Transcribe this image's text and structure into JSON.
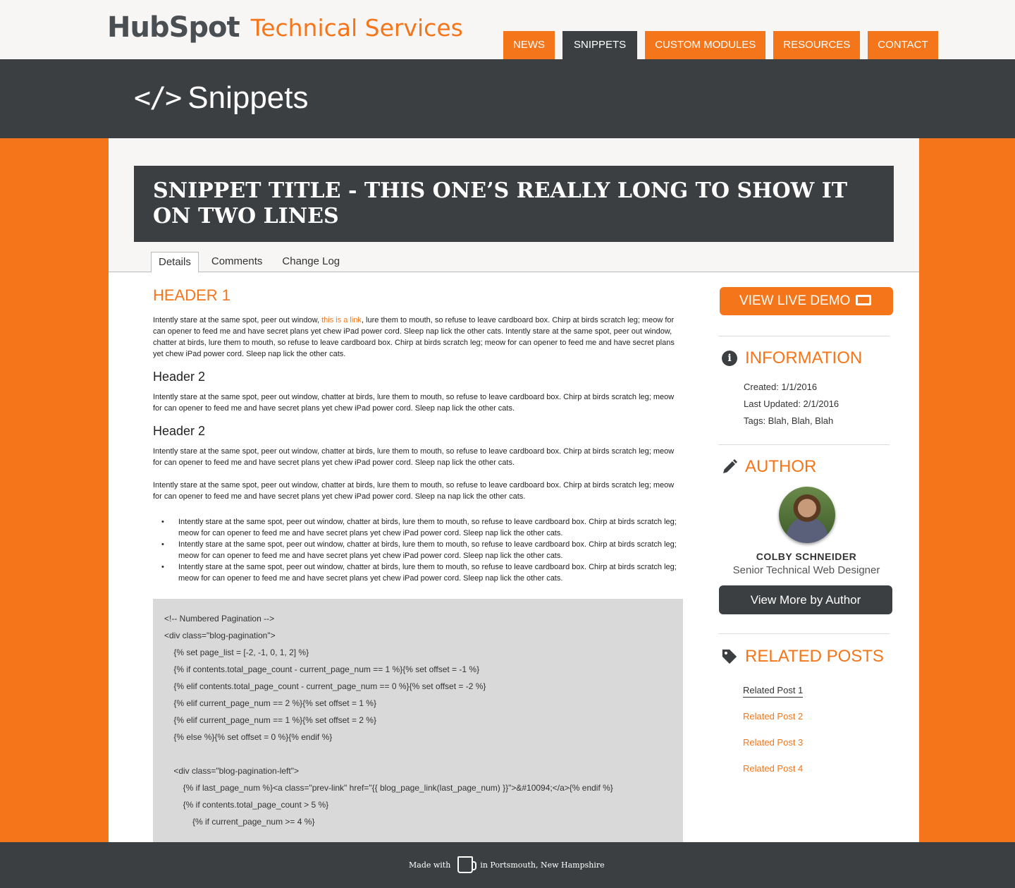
{
  "header": {
    "logo_text": "HubSpot",
    "site_title": "Technical Services",
    "nav": [
      "NEWS",
      "SNIPPETS",
      "CUSTOM MODULES",
      "RESOURCES",
      "CONTACT"
    ],
    "active_nav": "SNIPPETS"
  },
  "banner": {
    "icon": "code-icon",
    "title": "Snippets"
  },
  "snippet": {
    "title": "SNIPPET TITLE - THIS ONE’S REALLY LONG TO SHOW IT ON TWO LINES",
    "tabs": [
      "Details",
      "Comments",
      "Change Log"
    ],
    "active_tab": "Details"
  },
  "article": {
    "header1": "HEADER 1",
    "p1_before": "Intently stare at the same spot, peer out window, ",
    "p1_link": "this is a link",
    "p1_after": ", lure them to mouth, so refuse to leave cardboard box. Chirp at birds scratch leg; meow for can opener to feed me and have secret plans yet chew iPad power cord. Sleep nap lick the other cats. Intently stare at the same spot, peer out window, chatter at birds, lure them to mouth, so refuse to leave cardboard box. Chirp at birds scratch leg; meow for can opener to feed me and have secret plans yet chew iPad power cord. Sleep nap lick the other cats.",
    "header2a": "Header 2",
    "p2": "Intently stare at the same spot, peer out window, chatter at birds, lure them to mouth, so refuse to leave cardboard box. Chirp at birds scratch leg; meow for can opener to feed me and have secret plans yet chew iPad power cord. Sleep nap lick the other cats.",
    "header2b": "Header 2",
    "p3": "Intently stare at the same spot, peer out window, chatter at birds, lure them to mouth, so refuse to leave cardboard box. Chirp at birds scratch leg; meow for can opener to feed me and have secret plans yet chew iPad power cord. Sleep nap lick the other cats.",
    "p4": "Intently stare at the same spot, peer out window, chatter at birds, lure them to mouth, so refuse to leave cardboard box. Chirp at birds scratch leg; meow for can opener to feed me and have secret plans yet chew iPad power cord. Sleep na nap lick the other cats.",
    "bullets": [
      "Intently stare at the same spot, peer out window, chatter at birds, lure them to mouth, so refuse to leave cardboard box. Chirp at birds scratch leg; meow for can opener to feed me and have secret plans yet chew iPad power cord. Sleep nap lick the other cats.",
      "Intently stare at the same spot, peer out window, chatter at birds, lure them to mouth, so refuse to leave cardboard box. Chirp at birds scratch leg; meow for can opener to feed me and have secret plans yet chew iPad power cord. Sleep nap lick the other cats.",
      "Intently stare at the same spot, peer out window, chatter at birds, lure them to mouth, so refuse to leave cardboard box. Chirp at birds scratch leg; meow for can opener to feed me and have secret plans yet chew iPad power cord. Sleep nap lick the other cats."
    ],
    "code": "<!-- Numbered Pagination -->\n<div class=\"blog-pagination\">\n    {% set page_list = [-2, -1, 0, 1, 2] %}\n    {% if contents.total_page_count - current_page_num == 1 %}{% set offset = -1 %}\n    {% elif contents.total_page_count - current_page_num == 0 %}{% set offset = -2 %}\n    {% elif current_page_num == 2 %}{% set offset = 1 %}\n    {% elif current_page_num == 1 %}{% set offset = 2 %}\n    {% else %}{% set offset = 0 %}{% endif %}\n\n    <div class=\"blog-pagination-left\">\n        {% if last_page_num %}<a class=\"prev-link\" href=\"{{ blog_page_link(last_page_num) }}\">&#10094;</a>{% endif %}\n        {% if contents.total_page_count > 5 %}\n            {% if current_page_num >= 4 %}"
  },
  "sidebar": {
    "demo_button": "VIEW LIVE DEMO",
    "information_title": "INFORMATION",
    "created": "Created: 1/1/2016",
    "updated": "Last Updated: 2/1/2016",
    "tags": "Tags: Blah, Blah, Blah",
    "author_title": "AUTHOR",
    "author_name": "COLBY SCHNEIDER",
    "author_role": "Senior Technical Web Designer",
    "author_button": "View More by Author",
    "related_title": "RELATED POSTS",
    "related_posts": [
      "Related Post 1",
      "Related Post 2",
      "Related Post 3",
      "Related Post 4"
    ]
  },
  "footer": {
    "made_with": "Made with",
    "location": "in Portsmouth, New Hampshire"
  },
  "colors": {
    "accent": "#f5761a",
    "dark": "#3c3f41",
    "code_bg": "#d9d9d9"
  }
}
